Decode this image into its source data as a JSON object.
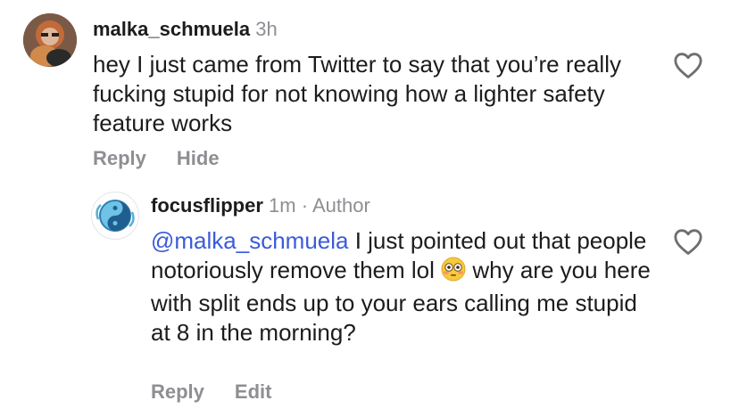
{
  "comments": [
    {
      "username": "malka_schmuela",
      "time": "3h",
      "text": "hey I just came from Twitter to say that you’re really fucking stupid for not knowing how a lighter safety feature works",
      "actions": [
        "Reply",
        "Hide"
      ],
      "avatar_icon": "profile-photo"
    },
    {
      "username": "focusflipper",
      "time": "1m",
      "separator": "·",
      "role": "Author",
      "mention": "@malka_schmuela",
      "text_before_emoji": " I just pointed out that people notoriously remove them lol",
      "emoji": "flushed-face-emoji",
      "text_after_emoji": " why are you here with split ends up to your ears calling me stupid at 8 in the morning?",
      "actions": [
        "Reply",
        "Edit"
      ],
      "avatar_icon": "yin-yang-avatar"
    }
  ],
  "icons": {
    "like": "heart-outline-icon"
  },
  "colors": {
    "mention": "#3b5bdb",
    "meta": "#8e8e93",
    "text": "#1c1c1e"
  }
}
